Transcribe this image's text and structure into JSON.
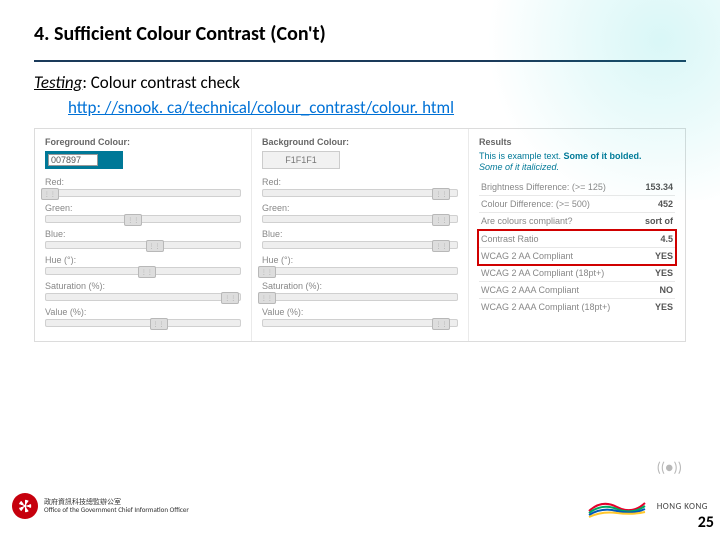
{
  "header": {
    "title": "4. Sufficient Colour Contrast (Con't)"
  },
  "subtitle": {
    "label": "Testing",
    "text": ": Colour contrast check"
  },
  "link": "http: //snook. ca/technical/colour_contrast/colour. html",
  "tool": {
    "foreground": {
      "title": "Foreground Colour:",
      "value": "007897",
      "sliders": [
        {
          "label": "Red:",
          "pos": 2
        },
        {
          "label": "Green:",
          "pos": 45
        },
        {
          "label": "Blue:",
          "pos": 56
        },
        {
          "label": "Hue (°):",
          "pos": 52
        },
        {
          "label": "Saturation (%):",
          "pos": 95
        },
        {
          "label": "Value (%):",
          "pos": 58
        }
      ]
    },
    "background": {
      "title": "Background Colour:",
      "value": "F1F1F1",
      "sliders": [
        {
          "label": "Red:",
          "pos": 92
        },
        {
          "label": "Green:",
          "pos": 92
        },
        {
          "label": "Blue:",
          "pos": 92
        },
        {
          "label": "Hue (°):",
          "pos": 2
        },
        {
          "label": "Saturation (%):",
          "pos": 2
        },
        {
          "label": "Value (%):",
          "pos": 92
        }
      ]
    },
    "results": {
      "title": "Results",
      "sample": {
        "line1": "This is example text. ",
        "bold": "Some of it bolded.",
        "line2": "Some of it italicized."
      },
      "rows": [
        {
          "label": "Brightness Difference: (>= 125)",
          "value": "153.34"
        },
        {
          "label": "Colour Difference: (>= 500)",
          "value": "452"
        },
        {
          "label": "Are colours compliant?",
          "value": "sort of"
        },
        {
          "label": "Contrast Ratio",
          "value": "4.5"
        },
        {
          "label": "WCAG 2 AA Compliant",
          "value": "YES"
        },
        {
          "label": "WCAG 2 AA Compliant (18pt+)",
          "value": "YES"
        },
        {
          "label": "WCAG 2 AAA Compliant",
          "value": "NO"
        },
        {
          "label": "WCAG 2 AAA Compliant (18pt+)",
          "value": "YES"
        }
      ]
    }
  },
  "footer": {
    "office_cn": "政府資訊科技總監辦公室",
    "office_en": "Office of the Government Chief Information Officer",
    "brand": "HONG KONG"
  },
  "page_number": "25"
}
